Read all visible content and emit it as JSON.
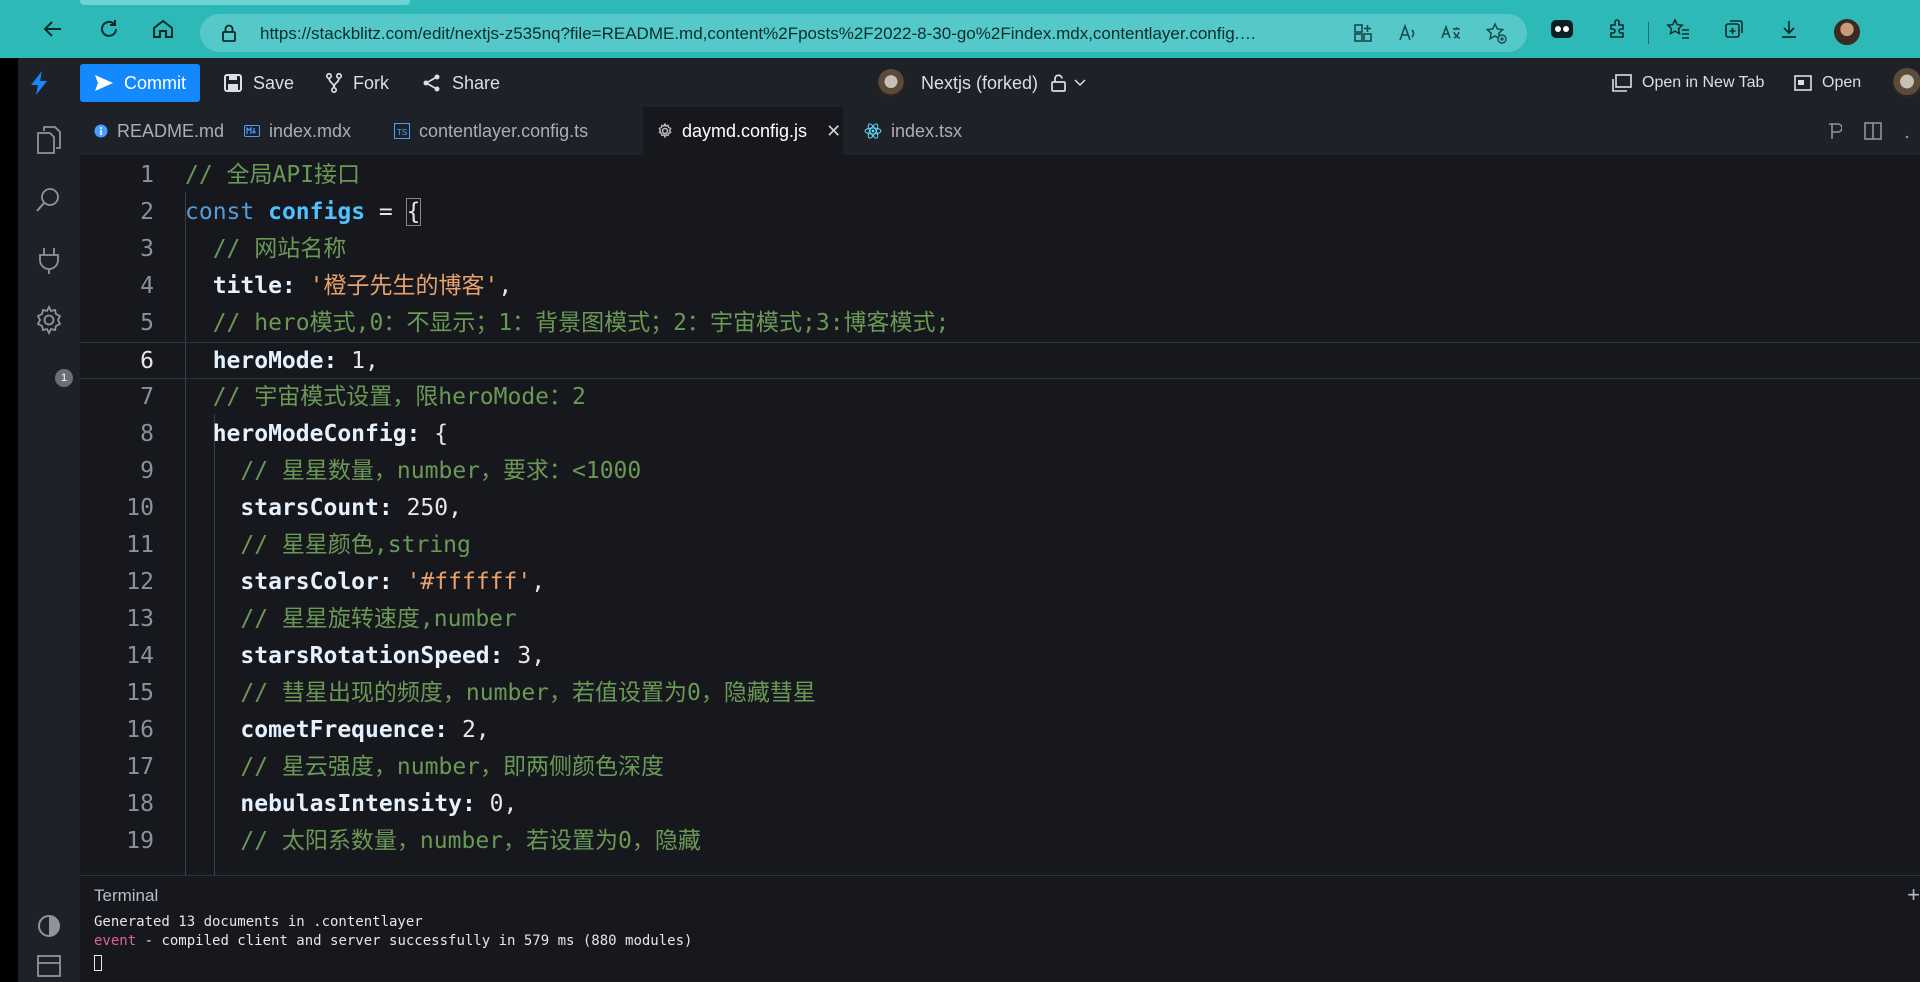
{
  "browser": {
    "url": "https://stackblitz.com/edit/nextjs-z535nq?file=README.md,content%2Fposts%2F2022-8-30-go%2Findex.mdx,contentlayer.config.ts,daym..."
  },
  "header": {
    "commit_label": "Commit",
    "save_label": "Save",
    "fork_label": "Fork",
    "share_label": "Share",
    "project_name": "Nextjs (forked)",
    "open_new_tab_label": "Open in New Tab",
    "open_label": "Open"
  },
  "activity": {
    "badge_count": "1"
  },
  "tabs": [
    {
      "label": "README.md",
      "icon": "info-icon"
    },
    {
      "label": "index.mdx",
      "icon": "markdown-icon"
    },
    {
      "label": "contentlayer.config.ts",
      "icon": "typescript-icon"
    },
    {
      "label": "daymd.config.js",
      "icon": "gear-icon"
    },
    {
      "label": "index.tsx",
      "icon": "react-icon"
    }
  ],
  "editor": {
    "current_line": 6,
    "lines": [
      {
        "n": "1",
        "tokens": [
          {
            "t": "// 全局API接口",
            "c": "c-comment"
          }
        ]
      },
      {
        "n": "2",
        "tokens": [
          {
            "t": "const",
            "c": "c-kw"
          },
          {
            "t": " ",
            "c": "c-punc"
          },
          {
            "t": "configs",
            "c": "c-var"
          },
          {
            "t": " = ",
            "c": "c-punc"
          },
          {
            "t": "{",
            "c": "c-punc bracket"
          }
        ]
      },
      {
        "n": "3",
        "tokens": [
          {
            "t": "  // 网站名称",
            "c": "c-comment"
          }
        ]
      },
      {
        "n": "4",
        "tokens": [
          {
            "t": "  title:",
            "c": "c-key"
          },
          {
            "t": " ",
            "c": "c-punc"
          },
          {
            "t": "'橙子先生的博客'",
            "c": "c-str"
          },
          {
            "t": ",",
            "c": "c-punc"
          }
        ]
      },
      {
        "n": "5",
        "tokens": [
          {
            "t": "  // hero模式,0：不显示；1：背景图模式；2：宇宙模式;3:博客模式;",
            "c": "c-comment"
          }
        ]
      },
      {
        "n": "6",
        "tokens": [
          {
            "t": "  heroMode:",
            "c": "c-key"
          },
          {
            "t": " 1,",
            "c": "c-num"
          }
        ]
      },
      {
        "n": "7",
        "tokens": [
          {
            "t": "  // 宇宙模式设置，限heroMode：2",
            "c": "c-comment"
          }
        ]
      },
      {
        "n": "8",
        "tokens": [
          {
            "t": "  heroModeConfig:",
            "c": "c-key"
          },
          {
            "t": " {",
            "c": "c-punc"
          }
        ]
      },
      {
        "n": "9",
        "tokens": [
          {
            "t": "    // 星星数量，number，要求：<1000",
            "c": "c-comment"
          }
        ]
      },
      {
        "n": "10",
        "tokens": [
          {
            "t": "    starsCount:",
            "c": "c-key"
          },
          {
            "t": " 250,",
            "c": "c-num"
          }
        ]
      },
      {
        "n": "11",
        "tokens": [
          {
            "t": "    // 星星颜色,string",
            "c": "c-comment"
          }
        ]
      },
      {
        "n": "12",
        "tokens": [
          {
            "t": "    starsColor:",
            "c": "c-key"
          },
          {
            "t": " ",
            "c": "c-punc"
          },
          {
            "t": "'#ffffff'",
            "c": "c-str"
          },
          {
            "t": ",",
            "c": "c-punc"
          }
        ]
      },
      {
        "n": "13",
        "tokens": [
          {
            "t": "    // 星星旋转速度,number",
            "c": "c-comment"
          }
        ]
      },
      {
        "n": "14",
        "tokens": [
          {
            "t": "    starsRotationSpeed:",
            "c": "c-key"
          },
          {
            "t": " 3,",
            "c": "c-num"
          }
        ]
      },
      {
        "n": "15",
        "tokens": [
          {
            "t": "    // 彗星出现的频度，number，若值设置为0，隐藏彗星",
            "c": "c-comment"
          }
        ]
      },
      {
        "n": "16",
        "tokens": [
          {
            "t": "    cometFrequence:",
            "c": "c-key"
          },
          {
            "t": " 2,",
            "c": "c-num"
          }
        ]
      },
      {
        "n": "17",
        "tokens": [
          {
            "t": "    // 星云强度，number，即两侧颜色深度",
            "c": "c-comment"
          }
        ]
      },
      {
        "n": "18",
        "tokens": [
          {
            "t": "    nebulasIntensity:",
            "c": "c-key"
          },
          {
            "t": " 0,",
            "c": "c-num"
          }
        ]
      },
      {
        "n": "19",
        "tokens": [
          {
            "t": "    // 太阳系数量，number，若设置为0，隐藏",
            "c": "c-comment"
          }
        ]
      }
    ]
  },
  "terminal": {
    "title": "Terminal",
    "line1": "Generated 13 documents in .contentlayer",
    "line2_prefix": "event",
    "line2_rest": " - compiled client and server successfully in 579 ms (880 modules)"
  }
}
